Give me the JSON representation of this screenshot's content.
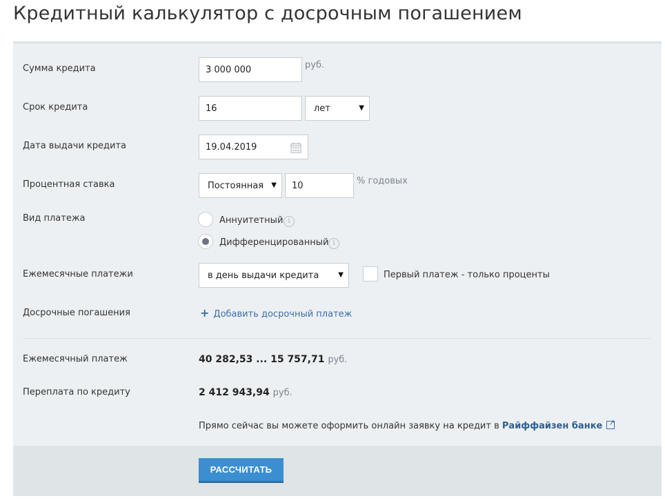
{
  "page": {
    "title": "Кредитный калькулятор с досрочным погашением"
  },
  "form": {
    "amount": {
      "label": "Сумма кредита",
      "value": "3 000 000",
      "unit": "руб."
    },
    "term": {
      "label": "Срок кредита",
      "value": "16",
      "unit_select": "лет"
    },
    "issue_date": {
      "label": "Дата выдачи кредита",
      "value": "19.04.2019"
    },
    "rate": {
      "label": "Процентная ставка",
      "type_select": "Постоянная",
      "value": "10",
      "unit": "% годовых"
    },
    "payment_type": {
      "label": "Вид платежа",
      "options": [
        {
          "label": "Аннуитетный",
          "checked": false
        },
        {
          "label": "Дифференцированный",
          "checked": true
        }
      ]
    },
    "monthly_payments": {
      "label": "Ежемесячные платежи",
      "select": "в день выдачи кредита",
      "checkbox_label": "Первый платеж - только проценты",
      "checkbox_checked": false
    },
    "early_payments": {
      "label": "Досрочные погашения",
      "add_link": "Добавить досрочный платеж"
    }
  },
  "results": {
    "monthly_payment": {
      "label": "Ежемесячный платеж",
      "value": "40 282,53 ... 15 757,71",
      "unit": "руб."
    },
    "overpayment": {
      "label": "Переплата по кредиту",
      "value": "2 412 943,94",
      "unit": "руб."
    },
    "offer_text": "Прямо сейчас вы можете оформить онлайн заявку на кредит в",
    "offer_bank": "Райффайзен банке"
  },
  "actions": {
    "calculate": "РАССЧИТАТЬ"
  },
  "colors": {
    "accent": "#3b8fd0",
    "link": "#3a6fa8",
    "panel": "#edf0f2"
  }
}
